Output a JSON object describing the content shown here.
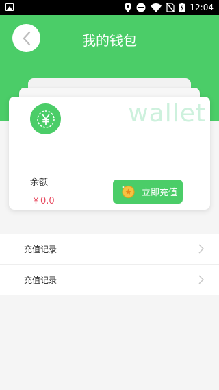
{
  "status_bar": {
    "time": "12:04",
    "icons": [
      "image-icon",
      "location-icon",
      "do-not-disturb-icon",
      "wifi-icon",
      "no-sim-icon",
      "battery-charging-icon"
    ]
  },
  "header": {
    "title": "我的钱包",
    "back_icon": "chevron-left-icon",
    "color": "#4bcd68"
  },
  "wallet_card": {
    "watermark": "wallet",
    "currency_icon": "yen-icon",
    "balance_label": "余额",
    "balance_value": "￥0.0",
    "recharge_button": "立即充值",
    "recharge_icon": "coin-icon"
  },
  "list": {
    "items": [
      {
        "label": "充值记录"
      },
      {
        "label": "充值记录"
      }
    ]
  },
  "colors": {
    "accent": "#4bcd68",
    "balance": "#e84a5f",
    "watermark": "#cdf1dd"
  }
}
